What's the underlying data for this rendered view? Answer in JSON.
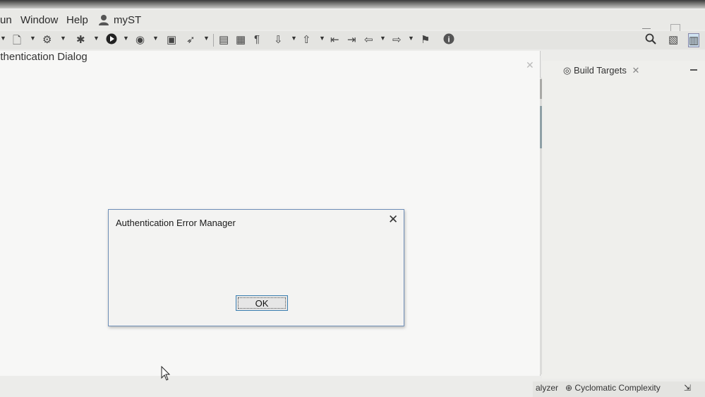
{
  "menubar": {
    "items": [
      "un",
      "Window",
      "Help"
    ],
    "user": "myST"
  },
  "editor": {
    "tab_title": "uthentication Dialog",
    "close_glyph": "✕"
  },
  "right_panel": {
    "tab_label": "Build Targets",
    "close_glyph": "✕"
  },
  "dialog": {
    "title": "Authentication Error Manager",
    "close_glyph": "✕",
    "ok_label": "OK"
  },
  "bottom_bar": {
    "left_label": "alyzer",
    "cyclomatic_label": "Cyclomatic Complexity"
  },
  "icons": {
    "search": "⌕",
    "info": "i"
  }
}
